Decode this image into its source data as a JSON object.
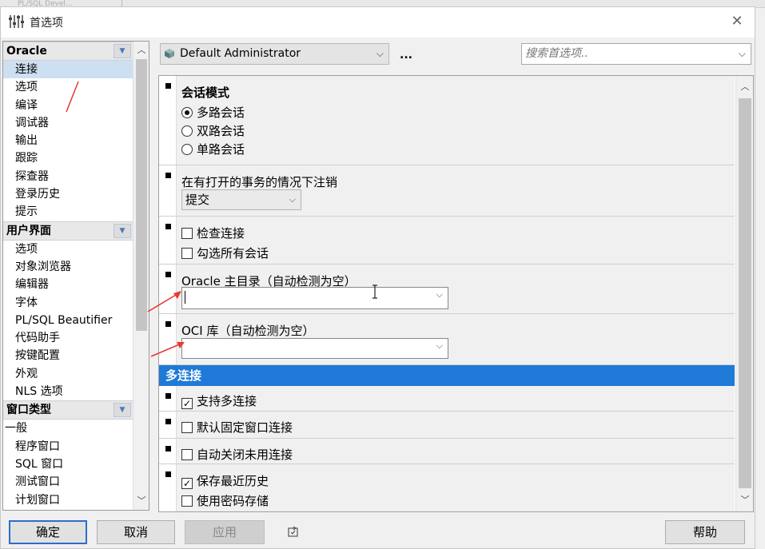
{
  "window": {
    "title": "首选项",
    "close_glyph": "✕"
  },
  "background": {
    "ghost_text": "PL/SQL Devel..."
  },
  "sidebar": {
    "categories": [
      {
        "label": "Oracle",
        "items": [
          "连接",
          "选项",
          "编译",
          "调试器",
          "输出",
          "跟踪",
          "探查器",
          "登录历史",
          "提示"
        ]
      },
      {
        "label": "用户界面",
        "items": [
          "选项",
          "对象浏览器",
          "编辑器",
          "字体",
          "PL/SQL Beautifier",
          "代码助手",
          "按键配置",
          "外观",
          "NLS 选项"
        ]
      },
      {
        "label": "窗口类型",
        "items": [
          "一般",
          "程序窗口",
          "SQL 窗口",
          "测试窗口",
          "计划窗口"
        ]
      }
    ],
    "selected": "连接"
  },
  "toolbar": {
    "profile": "Default Administrator",
    "more": "...",
    "search_placeholder": "搜索首选项..",
    "chevron": "⌵"
  },
  "sections": {
    "session_mode": {
      "title": "会话模式",
      "options": [
        "多路会话",
        "双路会话",
        "单路会话"
      ],
      "selected": 0
    },
    "logoff": {
      "label": "在有打开的事务的情况下注销",
      "value": "提交"
    },
    "check": {
      "items": [
        {
          "label": "检查连接",
          "checked": false
        },
        {
          "label": "勾选所有会话",
          "checked": false
        }
      ]
    },
    "oracle_home": {
      "label": "Oracle 主目录（自动检测为空）",
      "value": ""
    },
    "oci": {
      "label": "OCI 库（自动检测为空）",
      "value": ""
    },
    "multi": {
      "title": "多连接",
      "support": {
        "label": "支持多连接",
        "checked": true
      },
      "fixed": {
        "label": "默认固定窗口连接",
        "checked": false
      },
      "autoclose": {
        "label": "自动关闭未用连接",
        "checked": false
      },
      "history": [
        {
          "label": "保存最近历史",
          "checked": true
        },
        {
          "label": "使用密码存储",
          "checked": false
        }
      ]
    }
  },
  "buttons": {
    "ok": "确定",
    "cancel": "取消",
    "apply": "应用",
    "help": "帮助"
  },
  "colors": {
    "accent": "#1e7ad6",
    "selection": "#cde0f2",
    "annotation": "#e53935"
  }
}
